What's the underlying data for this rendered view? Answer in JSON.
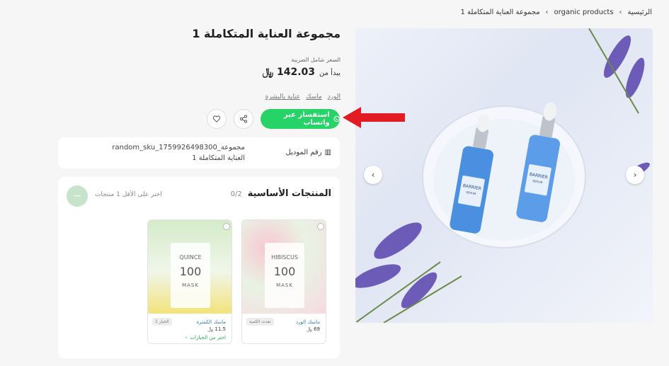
{
  "breadcrumb": {
    "home": "الرئيسية",
    "category": "organic products",
    "current": "مجموعة العناية المتكاملة 1",
    "separator": "›"
  },
  "product": {
    "title": "مجموعة العناية المتكاملة 1",
    "tax_note": "السعر شامل الضريبة",
    "price_prefix": "يبدأ من",
    "price": "142.03 ﷼",
    "tags": [
      "الورد",
      "ماسك",
      "عناية بالبشرة"
    ]
  },
  "actions": {
    "whatsapp_label": "استفسار عبر واتساب",
    "whatsapp_icon": "whatsapp-icon",
    "share_icon": "share-icon",
    "wishlist_icon": "heart-icon"
  },
  "model": {
    "label": "رقم الموديل",
    "icon": "barcode-icon",
    "value": "مجموعة_random_sku_1759926498300 العناية المتكاملة 1"
  },
  "bundle": {
    "title": "المنتجات الأساسية",
    "count": "0/2",
    "hint": "اختر على الأقل 1 منتجات"
  },
  "products": [
    {
      "pack_name": "HIBISCUS",
      "pack_number": "100",
      "pack_word": "MASK",
      "name": "ماسك الورد",
      "price": "69 ﷼",
      "badge": "نفذت الكمية"
    },
    {
      "pack_name": "QUINCE",
      "pack_number": "100",
      "pack_word": "MASK",
      "name": "ماسك الكمثرة",
      "price": "11.5 ﷼",
      "badge": "الخيار 1",
      "options": "اختر من الخيارات"
    }
  ],
  "gallery": {
    "bottle_label": "BARRIER",
    "bottle_sub": "SERUM",
    "prev_icon": "chevron-left-icon",
    "next_icon": "chevron-right-icon"
  },
  "colors": {
    "whatsapp": "#25d366",
    "annotation_arrow": "#e31b23",
    "bottle_blue": "#4a8fe0"
  }
}
